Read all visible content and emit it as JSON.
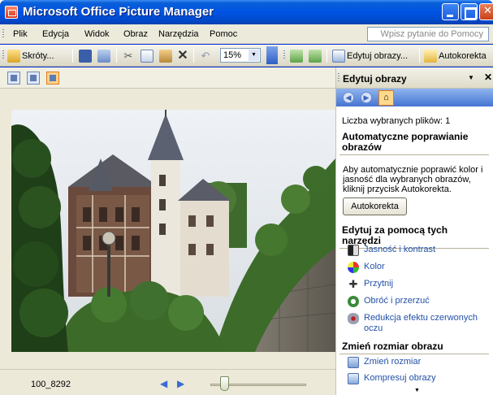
{
  "window": {
    "title": "Microsoft Office Picture Manager"
  },
  "menubar": {
    "items": [
      "Plik",
      "Edycja",
      "Widok",
      "Obraz",
      "Narzędzia",
      "Pomoc"
    ],
    "help_placeholder": "Wpisz pytanie do Pomocy"
  },
  "toolbar": {
    "shortcuts_label": "Skróty...",
    "zoom_value": "15%",
    "edit_label": "Edytuj obrazy...",
    "autocorrect_label": "Autokorekta"
  },
  "viewer": {
    "filename": "100_8292"
  },
  "taskpane": {
    "title": "Edytuj obrazy",
    "selected_count": "Liczba wybranych plików: 1",
    "auto_heading": "Automatyczne poprawianie obrazów",
    "auto_text": "Aby automatycznie poprawić kolor i jasność dla wybranych obrazów, kliknij przycisk Autokorekta.",
    "auto_button": "Autokorekta",
    "tools_heading": "Edytuj za pomocą tych narzędzi",
    "tools": [
      {
        "label": "Jasność i kontrast",
        "icon": "brightness-icon"
      },
      {
        "label": "Kolor",
        "icon": "color-icon"
      },
      {
        "label": "Przytnij",
        "icon": "crop-icon"
      },
      {
        "label": "Obróć i przerzuć",
        "icon": "rotate-icon"
      },
      {
        "label": "Redukcja efektu czerwonych oczu",
        "icon": "red-eye-icon"
      }
    ],
    "resize_heading": "Zmień rozmiar obrazu",
    "resize_tools": [
      {
        "label": "Zmień rozmiar",
        "icon": "resize-icon"
      },
      {
        "label": "Kompresuj obrazy",
        "icon": "compress-icon"
      }
    ]
  }
}
